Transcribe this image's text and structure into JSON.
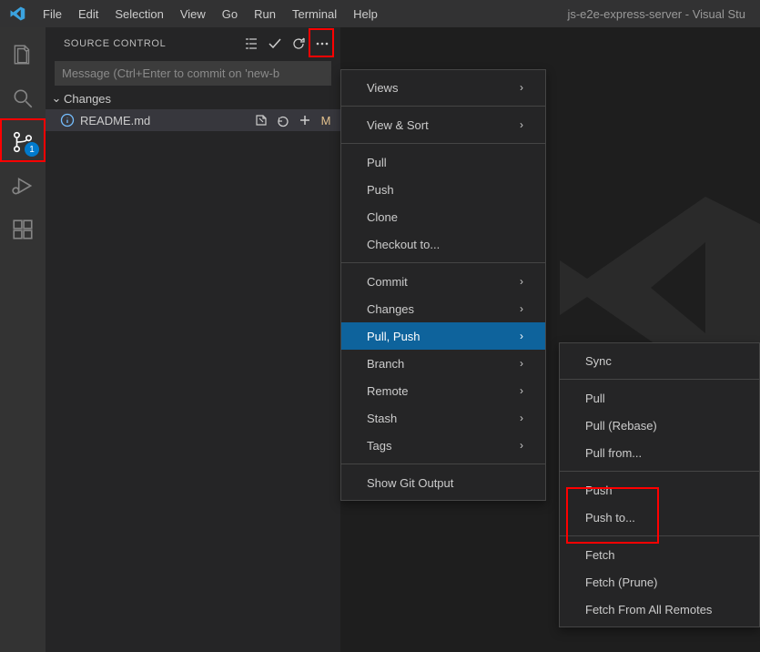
{
  "titlebar": {
    "menus": [
      "File",
      "Edit",
      "Selection",
      "View",
      "Go",
      "Run",
      "Terminal",
      "Help"
    ],
    "title": "js-e2e-express-server - Visual Stu"
  },
  "activitybar": {
    "badge": "1",
    "items": [
      "files",
      "search",
      "source-control",
      "debug",
      "extensions"
    ]
  },
  "sidebar": {
    "title": "SOURCE CONTROL",
    "commit_placeholder": "Message (Ctrl+Enter to commit on 'new-b",
    "changes_label": "Changes",
    "file": {
      "name": "README.md",
      "status": "M"
    }
  },
  "menu1": {
    "items": [
      {
        "label": "Views",
        "sub": true
      },
      {
        "sep": true
      },
      {
        "label": "View & Sort",
        "sub": true
      },
      {
        "sep": true
      },
      {
        "label": "Pull"
      },
      {
        "label": "Push"
      },
      {
        "label": "Clone"
      },
      {
        "label": "Checkout to..."
      },
      {
        "sep": true
      },
      {
        "label": "Commit",
        "sub": true
      },
      {
        "label": "Changes",
        "sub": true
      },
      {
        "label": "Pull, Push",
        "sub": true,
        "selected": true
      },
      {
        "label": "Branch",
        "sub": true
      },
      {
        "label": "Remote",
        "sub": true
      },
      {
        "label": "Stash",
        "sub": true
      },
      {
        "label": "Tags",
        "sub": true
      },
      {
        "sep": true
      },
      {
        "label": "Show Git Output"
      }
    ]
  },
  "menu2": {
    "items": [
      {
        "label": "Sync"
      },
      {
        "sep": true
      },
      {
        "label": "Pull"
      },
      {
        "label": "Pull (Rebase)"
      },
      {
        "label": "Pull from..."
      },
      {
        "sep": true
      },
      {
        "label": "Push"
      },
      {
        "label": "Push to..."
      },
      {
        "sep": true
      },
      {
        "label": "Fetch"
      },
      {
        "label": "Fetch (Prune)"
      },
      {
        "label": "Fetch From All Remotes"
      }
    ]
  }
}
